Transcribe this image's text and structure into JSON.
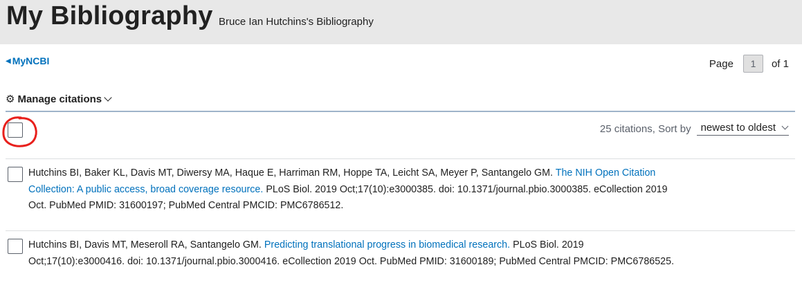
{
  "header": {
    "title": "My Bibliography",
    "subtitle": "Bruce Ian Hutchins's Bibliography"
  },
  "nav": {
    "back_label": "MyNCBI",
    "back_icon": "caret-left-icon"
  },
  "pager": {
    "page_label": "Page",
    "current_page": "1",
    "of_label": "of 1"
  },
  "manage": {
    "label": "Manage citations",
    "icon": "gear-icon"
  },
  "toolbar": {
    "count_text": "25 citations, Sort by",
    "sort_value": "newest to oldest"
  },
  "annotation_color": "#e8201c",
  "link_color": "#0071bc",
  "citations": [
    {
      "authors": "Hutchins BI, Baker KL, Davis MT, Diwersy MA, Haque E, Harriman RM, Hoppe TA, Leicht SA, Meyer P, Santangelo GM.",
      "title_part1": "The NIH Open Citation",
      "title_part2": "Collection: A public access, broad coverage resource.",
      "details1": "PLoS Biol. 2019 Oct;17(10):e3000385. doi: 10.1371/journal.pbio.3000385. eCollection 2019",
      "details2": "Oct. PubMed PMID: 31600197; PubMed Central PMCID: PMC6786512."
    },
    {
      "authors": "Hutchins BI, Davis MT, Meseroll RA, Santangelo GM.",
      "title": "Predicting translational progress in biomedical research.",
      "details1": "PLoS Biol. 2019",
      "details2": "Oct;17(10):e3000416. doi: 10.1371/journal.pbio.3000416. eCollection 2019 Oct. PubMed PMID: 31600189; PubMed Central PMCID: PMC6786525."
    }
  ]
}
